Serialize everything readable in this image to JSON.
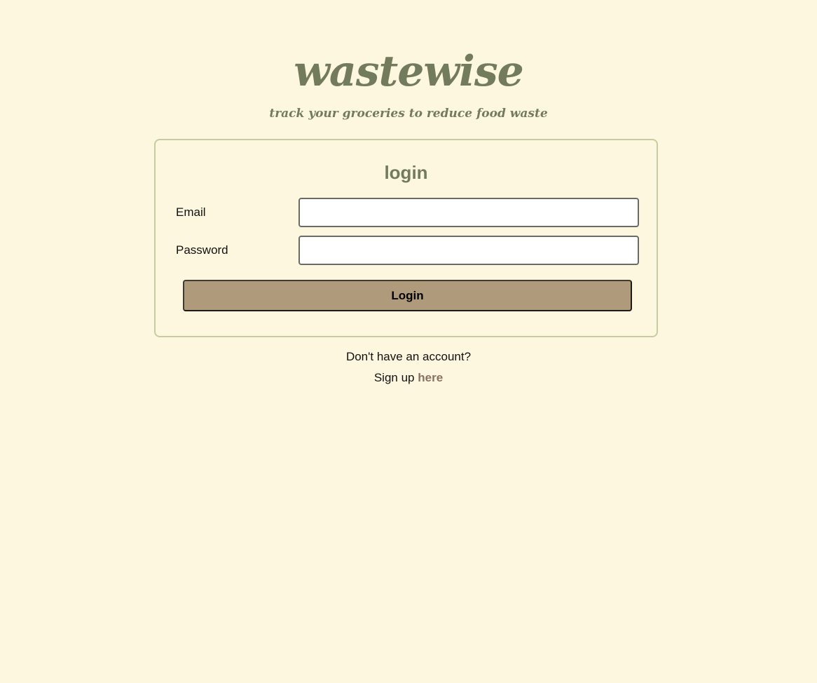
{
  "header": {
    "brand": "wastewise",
    "tagline": "track your groceries to reduce food waste"
  },
  "login_card": {
    "title": "login",
    "email_label": "Email",
    "email_value": "",
    "password_label": "Password",
    "password_value": "",
    "submit_label": "Login"
  },
  "signup": {
    "prompt": "Don't have an account?",
    "lead_text": "Sign up",
    "link_text": "here"
  },
  "colors": {
    "background": "#fdf7df",
    "brand": "#737b5d",
    "card_border": "#c5cca0",
    "button": "#b09a7c",
    "link": "#8a7262"
  }
}
